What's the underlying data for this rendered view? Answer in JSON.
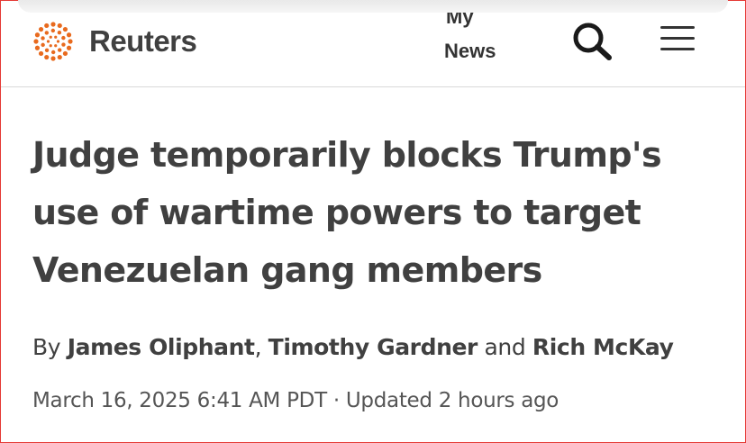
{
  "header": {
    "logo_text": "Reuters",
    "mynews_line1": "My",
    "mynews_line2": "News",
    "search_icon": "search-icon",
    "menu_icon": "hamburger-menu-icon",
    "brand_color": "#E86A1E",
    "text_color": "#404040"
  },
  "article": {
    "headline": "Judge temporarily blocks Trump's use of wartime powers to target Venezuelan gang members",
    "byline": {
      "prefix": "By ",
      "author1": "James Oliphant",
      "sep1": ", ",
      "author2": "Timothy Gardner",
      "sep2": " and ",
      "author3": "Rich McKay"
    },
    "date": "March 16, 2025 6:41 AM PDT",
    "separator": " · ",
    "updated": "Updated 2 hours ago"
  }
}
